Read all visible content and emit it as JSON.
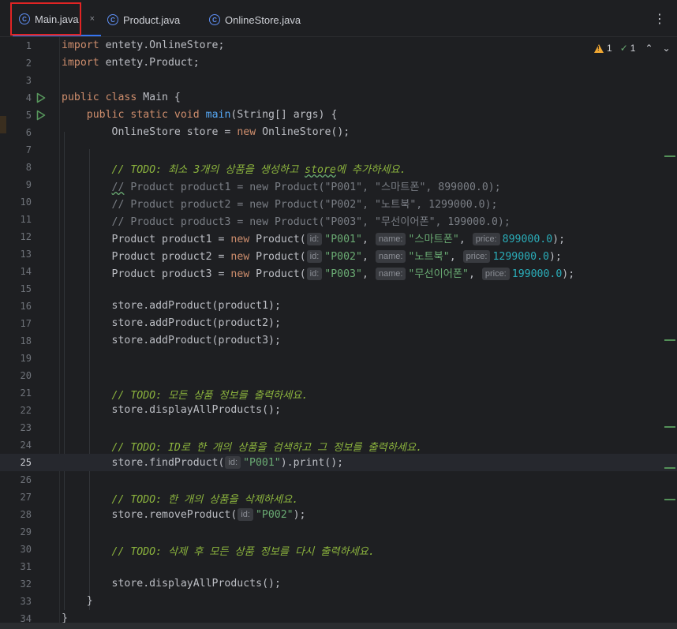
{
  "tabs": [
    {
      "label": "Main.java",
      "active": true,
      "icon": "java-class-run-icon"
    },
    {
      "label": "Product.java",
      "active": false,
      "icon": "java-class-icon"
    },
    {
      "label": "OnlineStore.java",
      "active": false,
      "icon": "java-class-icon"
    }
  ],
  "tab_close_glyph": "×",
  "more_glyph": "⋮",
  "inspections": {
    "warnings": "1",
    "typos": "1"
  },
  "current_line": 25,
  "run_lines": [
    4,
    5
  ],
  "lines": [
    {
      "n": "1",
      "segs": [
        {
          "c": "kw",
          "t": "import"
        },
        {
          "c": "",
          "t": " entety.OnlineStore;"
        }
      ]
    },
    {
      "n": "2",
      "segs": [
        {
          "c": "kw",
          "t": "import"
        },
        {
          "c": "",
          "t": " entety.Product;"
        }
      ]
    },
    {
      "n": "3",
      "segs": []
    },
    {
      "n": "4",
      "segs": [
        {
          "c": "kw",
          "t": "public class"
        },
        {
          "c": "",
          "t": " Main {"
        }
      ]
    },
    {
      "n": "5",
      "segs": [
        {
          "c": "",
          "t": "    "
        },
        {
          "c": "kw",
          "t": "public static void"
        },
        {
          "c": "",
          "t": " "
        },
        {
          "c": "fn",
          "t": "main"
        },
        {
          "c": "",
          "t": "(String[] args) {"
        }
      ]
    },
    {
      "n": "6",
      "segs": [
        {
          "c": "",
          "t": "        OnlineStore store = "
        },
        {
          "c": "kw",
          "t": "new"
        },
        {
          "c": "",
          "t": " OnlineStore();"
        }
      ]
    },
    {
      "n": "7",
      "segs": []
    },
    {
      "n": "8",
      "segs": [
        {
          "c": "",
          "t": "        "
        },
        {
          "c": "todo",
          "t": "// TODO: 최소 3개의 상품을 생성하고 "
        },
        {
          "c": "todo ul",
          "t": "store"
        },
        {
          "c": "todo",
          "t": "에 추가하세요."
        }
      ]
    },
    {
      "n": "9",
      "segs": [
        {
          "c": "",
          "t": "        "
        },
        {
          "c": "cmt ul",
          "t": "//"
        },
        {
          "c": "cmt",
          "t": " Product product1 = new Product(\"P001\", \"스마트폰\", 899000.0);"
        }
      ]
    },
    {
      "n": "10",
      "segs": [
        {
          "c": "",
          "t": "        "
        },
        {
          "c": "cmt",
          "t": "// Product product2 = new Product(\"P002\", \"노트북\", 1299000.0);"
        }
      ]
    },
    {
      "n": "11",
      "segs": [
        {
          "c": "",
          "t": "        "
        },
        {
          "c": "cmt",
          "t": "// Product product3 = new Product(\"P003\", \"무선이어폰\", 199000.0);"
        }
      ]
    },
    {
      "n": "12",
      "segs": [
        {
          "c": "",
          "t": "        Product product1 = "
        },
        {
          "c": "kw",
          "t": "new"
        },
        {
          "c": "",
          "t": " Product("
        },
        {
          "c": "hint",
          "t": "id:"
        },
        {
          "c": "str",
          "t": "\"P001\""
        },
        {
          "c": "",
          "t": ", "
        },
        {
          "c": "hint",
          "t": "name:"
        },
        {
          "c": "str",
          "t": "\"스마트폰\""
        },
        {
          "c": "",
          "t": ", "
        },
        {
          "c": "hint",
          "t": "price:"
        },
        {
          "c": "num",
          "t": "899000.0"
        },
        {
          "c": "",
          "t": ");"
        }
      ]
    },
    {
      "n": "13",
      "segs": [
        {
          "c": "",
          "t": "        Product product2 = "
        },
        {
          "c": "kw",
          "t": "new"
        },
        {
          "c": "",
          "t": " Product("
        },
        {
          "c": "hint",
          "t": "id:"
        },
        {
          "c": "str",
          "t": "\"P002\""
        },
        {
          "c": "",
          "t": ", "
        },
        {
          "c": "hint",
          "t": "name:"
        },
        {
          "c": "str",
          "t": "\"노트북\""
        },
        {
          "c": "",
          "t": ", "
        },
        {
          "c": "hint",
          "t": "price:"
        },
        {
          "c": "num",
          "t": "1299000.0"
        },
        {
          "c": "",
          "t": ");"
        }
      ]
    },
    {
      "n": "14",
      "segs": [
        {
          "c": "",
          "t": "        Product product3 = "
        },
        {
          "c": "kw",
          "t": "new"
        },
        {
          "c": "",
          "t": " Product("
        },
        {
          "c": "hint",
          "t": "id:"
        },
        {
          "c": "str",
          "t": "\"P003\""
        },
        {
          "c": "",
          "t": ", "
        },
        {
          "c": "hint",
          "t": "name:"
        },
        {
          "c": "str",
          "t": "\"무선이어폰\""
        },
        {
          "c": "",
          "t": ", "
        },
        {
          "c": "hint",
          "t": "price:"
        },
        {
          "c": "num",
          "t": "199000.0"
        },
        {
          "c": "",
          "t": ");"
        }
      ]
    },
    {
      "n": "15",
      "segs": []
    },
    {
      "n": "16",
      "segs": [
        {
          "c": "",
          "t": "        store.addProduct(product1);"
        }
      ]
    },
    {
      "n": "17",
      "segs": [
        {
          "c": "",
          "t": "        store.addProduct(product2);"
        }
      ]
    },
    {
      "n": "18",
      "segs": [
        {
          "c": "",
          "t": "        store.addProduct(product3);"
        }
      ]
    },
    {
      "n": "19",
      "segs": []
    },
    {
      "n": "20",
      "segs": []
    },
    {
      "n": "21",
      "segs": [
        {
          "c": "",
          "t": "        "
        },
        {
          "c": "todo",
          "t": "// TODO: 모든 상품 정보를 출력하세요."
        }
      ]
    },
    {
      "n": "22",
      "segs": [
        {
          "c": "",
          "t": "        store.displayAllProducts();"
        }
      ]
    },
    {
      "n": "23",
      "segs": []
    },
    {
      "n": "24",
      "segs": [
        {
          "c": "",
          "t": "        "
        },
        {
          "c": "todo",
          "t": "// TODO: ID로 한 개의 상품을 검색하고 그 정보를 출력하세요."
        }
      ]
    },
    {
      "n": "25",
      "segs": [
        {
          "c": "",
          "t": "        store.findProduct("
        },
        {
          "c": "hint",
          "t": "id:"
        },
        {
          "c": "str",
          "t": "\"P001\""
        },
        {
          "c": "",
          "t": ").print();"
        }
      ]
    },
    {
      "n": "26",
      "segs": []
    },
    {
      "n": "27",
      "segs": [
        {
          "c": "",
          "t": "        "
        },
        {
          "c": "todo",
          "t": "// TODO: 한 개의 상품을 삭제하세요."
        }
      ]
    },
    {
      "n": "28",
      "segs": [
        {
          "c": "",
          "t": "        store.removeProduct("
        },
        {
          "c": "hint",
          "t": "id:"
        },
        {
          "c": "str",
          "t": "\"P002\""
        },
        {
          "c": "",
          "t": ");"
        }
      ]
    },
    {
      "n": "29",
      "segs": []
    },
    {
      "n": "30",
      "segs": [
        {
          "c": "",
          "t": "        "
        },
        {
          "c": "todo",
          "t": "// TODO: 삭제 후 모든 상품 정보를 다시 출력하세요."
        }
      ]
    },
    {
      "n": "31",
      "segs": []
    },
    {
      "n": "32",
      "segs": [
        {
          "c": "",
          "t": "        store.displayAllProducts();"
        }
      ]
    },
    {
      "n": "33",
      "segs": [
        {
          "c": "",
          "t": "    }"
        }
      ]
    },
    {
      "n": "34",
      "segs": [
        {
          "c": "",
          "t": "}"
        }
      ]
    }
  ]
}
